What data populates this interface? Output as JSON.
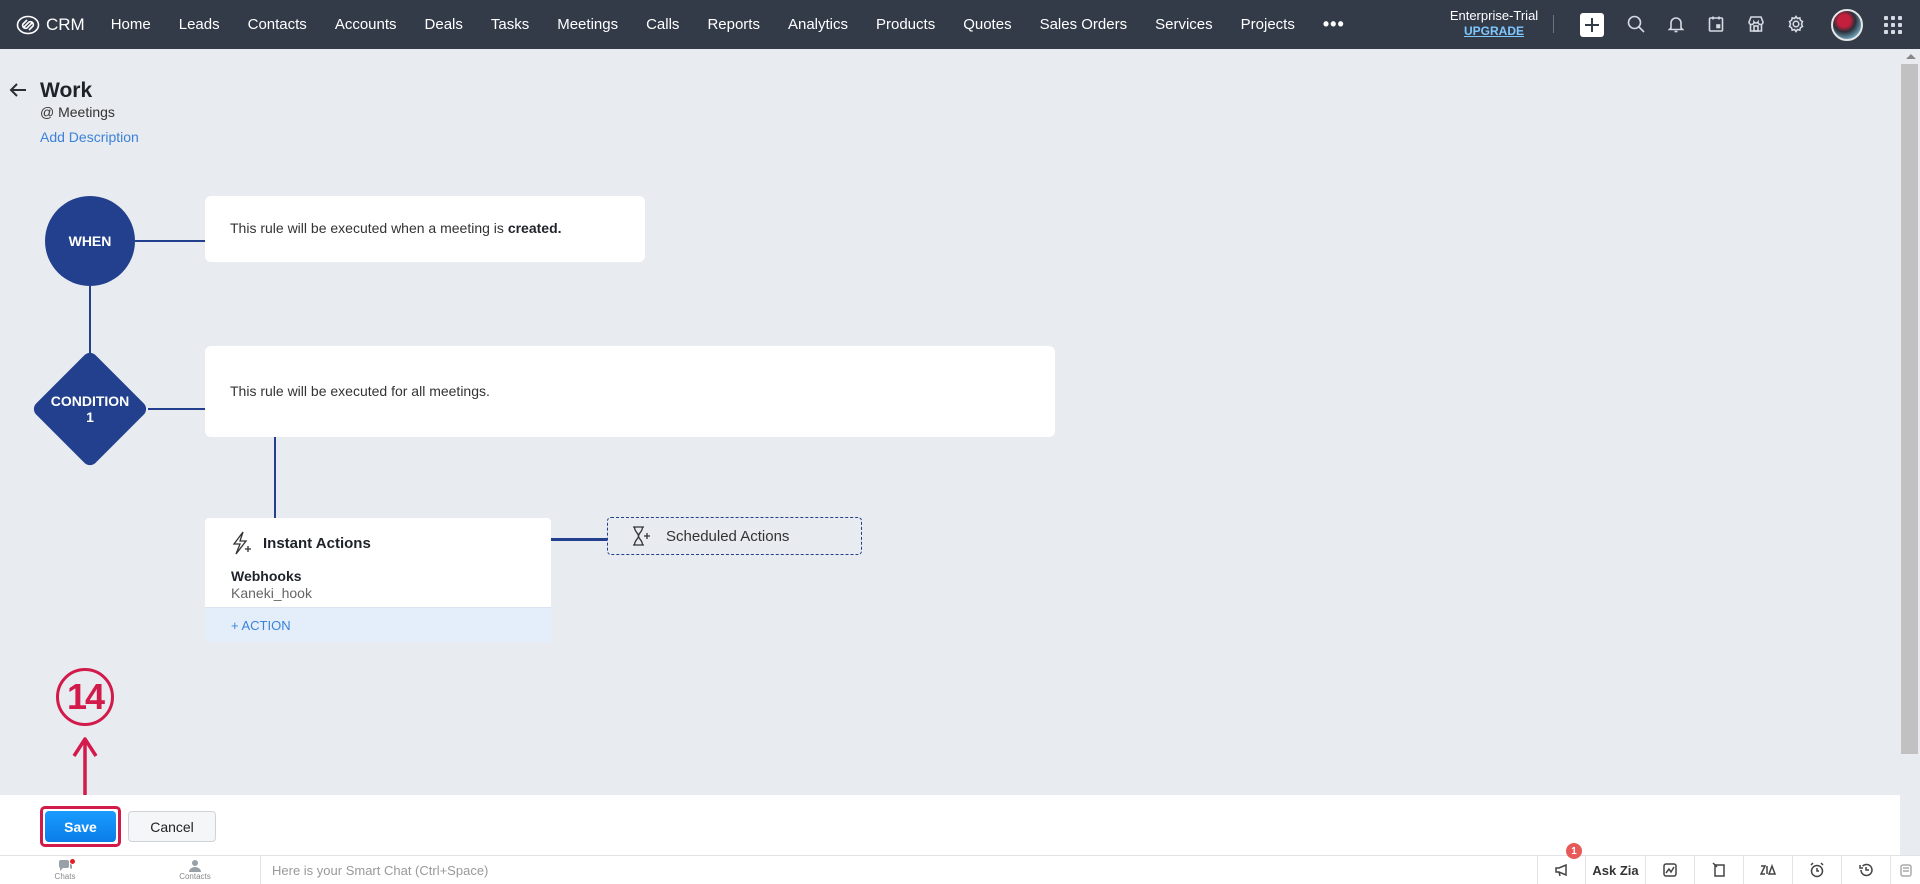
{
  "topbar": {
    "brand": "CRM",
    "nav_items": [
      "Home",
      "Leads",
      "Contacts",
      "Accounts",
      "Deals",
      "Tasks",
      "Meetings",
      "Calls",
      "Reports",
      "Analytics",
      "Products",
      "Quotes",
      "Sales Orders",
      "Services",
      "Projects"
    ],
    "more_label": "•••",
    "plan_label": "Enterprise-Trial",
    "upgrade_label": "UPGRADE",
    "icons": [
      "plus-icon",
      "search-icon",
      "bell-icon",
      "calendar-icon",
      "marketplace-icon",
      "gear-icon",
      "avatar",
      "apps-grid-icon"
    ]
  },
  "rule": {
    "title": "Work",
    "module": "@ Meetings",
    "add_description": "Add Description"
  },
  "flow": {
    "when_node": "WHEN",
    "when_text_prefix": "This rule will be executed when a meeting is ",
    "when_text_bold": "created.",
    "condition_node_line1": "CONDITION",
    "condition_node_line2": "1",
    "condition_text": "This rule will be executed for all meetings.",
    "instant_actions": {
      "title": "Instant Actions",
      "action_type": "Webhooks",
      "action_name": "Kaneki_hook",
      "add_action": "+ ACTION"
    },
    "scheduled_actions": {
      "title": "Scheduled Actions"
    }
  },
  "annotation": {
    "step_number": "14",
    "color": "#d21a4b"
  },
  "footer": {
    "save_label": "Save",
    "cancel_label": "Cancel"
  },
  "bottombar": {
    "chats_label": "Chats",
    "contacts_label": "Contacts",
    "smart_chat_placeholder": "Here is your Smart Chat (Ctrl+Space)",
    "announcement_badge": "1",
    "ask_zia_label": "Ask Zia"
  },
  "colors": {
    "topbar_bg": "#333a48",
    "flow_accent": "#23408e",
    "link": "#3b82d8",
    "save_button": "#0a7de8"
  }
}
